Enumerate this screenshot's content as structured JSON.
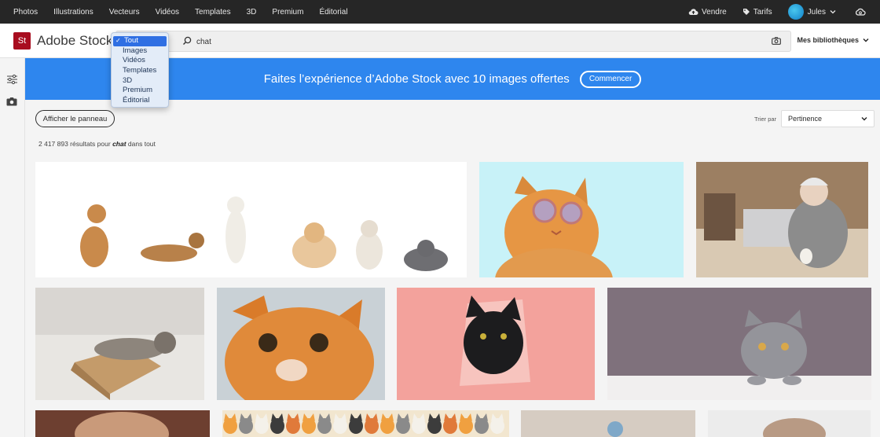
{
  "topnav": {
    "items": [
      "Photos",
      "Illustrations",
      "Vecteurs",
      "Vidéos",
      "Templates",
      "3D",
      "Premium",
      "Éditorial"
    ],
    "sell": "Vendre",
    "pricing": "Tarifs",
    "user": "Jules"
  },
  "header": {
    "logo_mark": "St",
    "logo_text": "Adobe Stock",
    "search_value": "chat",
    "libraries": "Mes bibliothèques"
  },
  "dropdown": {
    "options": [
      "Tout",
      "Images",
      "Vidéos",
      "Templates",
      "3D",
      "Premium",
      "Éditorial"
    ],
    "selected": "Tout",
    "checkmark": "✓"
  },
  "banner": {
    "text": "Faites l’expérience d’Adobe Stock avec 10 images offertes",
    "button": "Commencer"
  },
  "toolbar": {
    "panel_button": "Afficher le panneau",
    "sort_label": "Trier par",
    "sort_value": "Pertinence"
  },
  "results": {
    "count": "2 417 893 résultats pour",
    "query": "chat",
    "scope": "dans tout"
  },
  "colors": {
    "topnav": "#262626",
    "banner": "#2e86ee",
    "brand": "#a80d1f",
    "dropdown_selected": "#2f6fe3"
  },
  "icons": [
    "upload-cloud-icon",
    "tag-icon",
    "chevron-down-icon",
    "creative-cloud-icon",
    "search-icon",
    "camera-icon",
    "filter-sliders-icon",
    "checkmark-icon"
  ]
}
